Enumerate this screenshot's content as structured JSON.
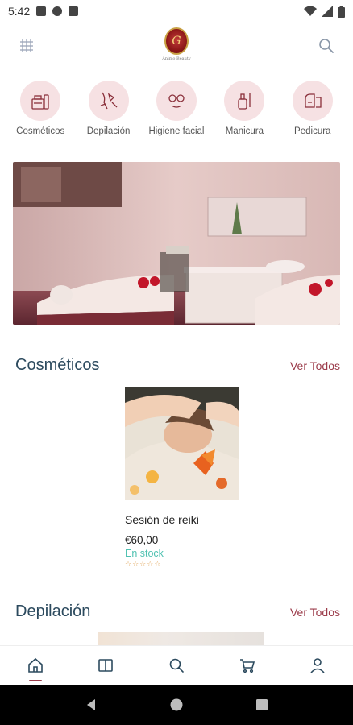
{
  "status_bar": {
    "time": "5:42"
  },
  "header": {
    "logo_text": "G",
    "logo_caption": "Ánimo Beauty"
  },
  "categories": [
    {
      "label": "Cosméticos",
      "icon": "cosmetics-icon"
    },
    {
      "label": "Depilación",
      "icon": "hair-removal-icon"
    },
    {
      "label": "Higiene facial",
      "icon": "facial-icon"
    },
    {
      "label": "Manicura",
      "icon": "manicure-icon"
    },
    {
      "label": "Pedicura",
      "icon": "pedicure-icon"
    }
  ],
  "sections": [
    {
      "title": "Cosméticos",
      "see_all": "Ver Todos"
    },
    {
      "title": "Depilación",
      "see_all": "Ver Todos"
    }
  ],
  "products": [
    {
      "name": "Sesión de reiki",
      "price": "€60,00",
      "stock": "En stock",
      "rating": 0
    }
  ],
  "colors": {
    "accent": "#9b3b4a",
    "title": "#2c4a5e",
    "stock": "#4fc1b1",
    "category_bg": "#f6e1e3"
  },
  "bottom_nav": [
    {
      "name": "home",
      "icon": "home-icon",
      "active": true
    },
    {
      "name": "catalog",
      "icon": "book-icon",
      "active": false
    },
    {
      "name": "search",
      "icon": "search-icon",
      "active": false
    },
    {
      "name": "cart",
      "icon": "cart-icon",
      "active": false
    },
    {
      "name": "account",
      "icon": "user-icon",
      "active": false
    }
  ]
}
